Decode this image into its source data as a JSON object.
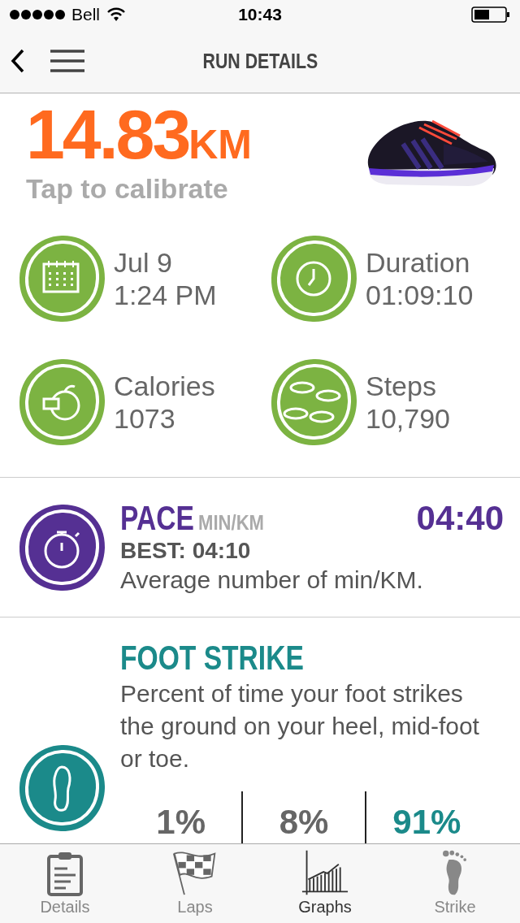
{
  "status_bar": {
    "carrier": "Bell",
    "time": "10:43"
  },
  "nav": {
    "title": "RUN DETAILS"
  },
  "distance": {
    "value": "14.83",
    "unit": "KM",
    "hint": "Tap to calibrate"
  },
  "stats": [
    {
      "kind": "calendar",
      "label": "Jul 9",
      "value": "1:24 PM"
    },
    {
      "kind": "clock",
      "label": "Duration",
      "value": "01:09:10"
    },
    {
      "kind": "apple",
      "label": "Calories",
      "value": "1073"
    },
    {
      "kind": "steps",
      "label": "Steps",
      "value": "10,790"
    }
  ],
  "pace": {
    "title": "PACE",
    "unit": "MIN/KM",
    "value": "04:40",
    "best": "BEST: 04:10",
    "description": "Average number of min/KM."
  },
  "foot_strike": {
    "title": "FOOT STRIKE",
    "description": "Percent of time your foot strikes the ground on your heel, mid-foot or toe.",
    "parts": [
      {
        "value": "1%",
        "selected": false
      },
      {
        "value": "8%",
        "selected": false
      },
      {
        "value": "91%",
        "selected": true
      }
    ]
  },
  "tabs": [
    {
      "kind": "clipboard",
      "label": "Details",
      "selected": false
    },
    {
      "kind": "flag",
      "label": "Laps",
      "selected": false
    },
    {
      "kind": "graph",
      "label": "Graphs",
      "selected": true
    },
    {
      "kind": "foot",
      "label": "Strike",
      "selected": false
    }
  ]
}
